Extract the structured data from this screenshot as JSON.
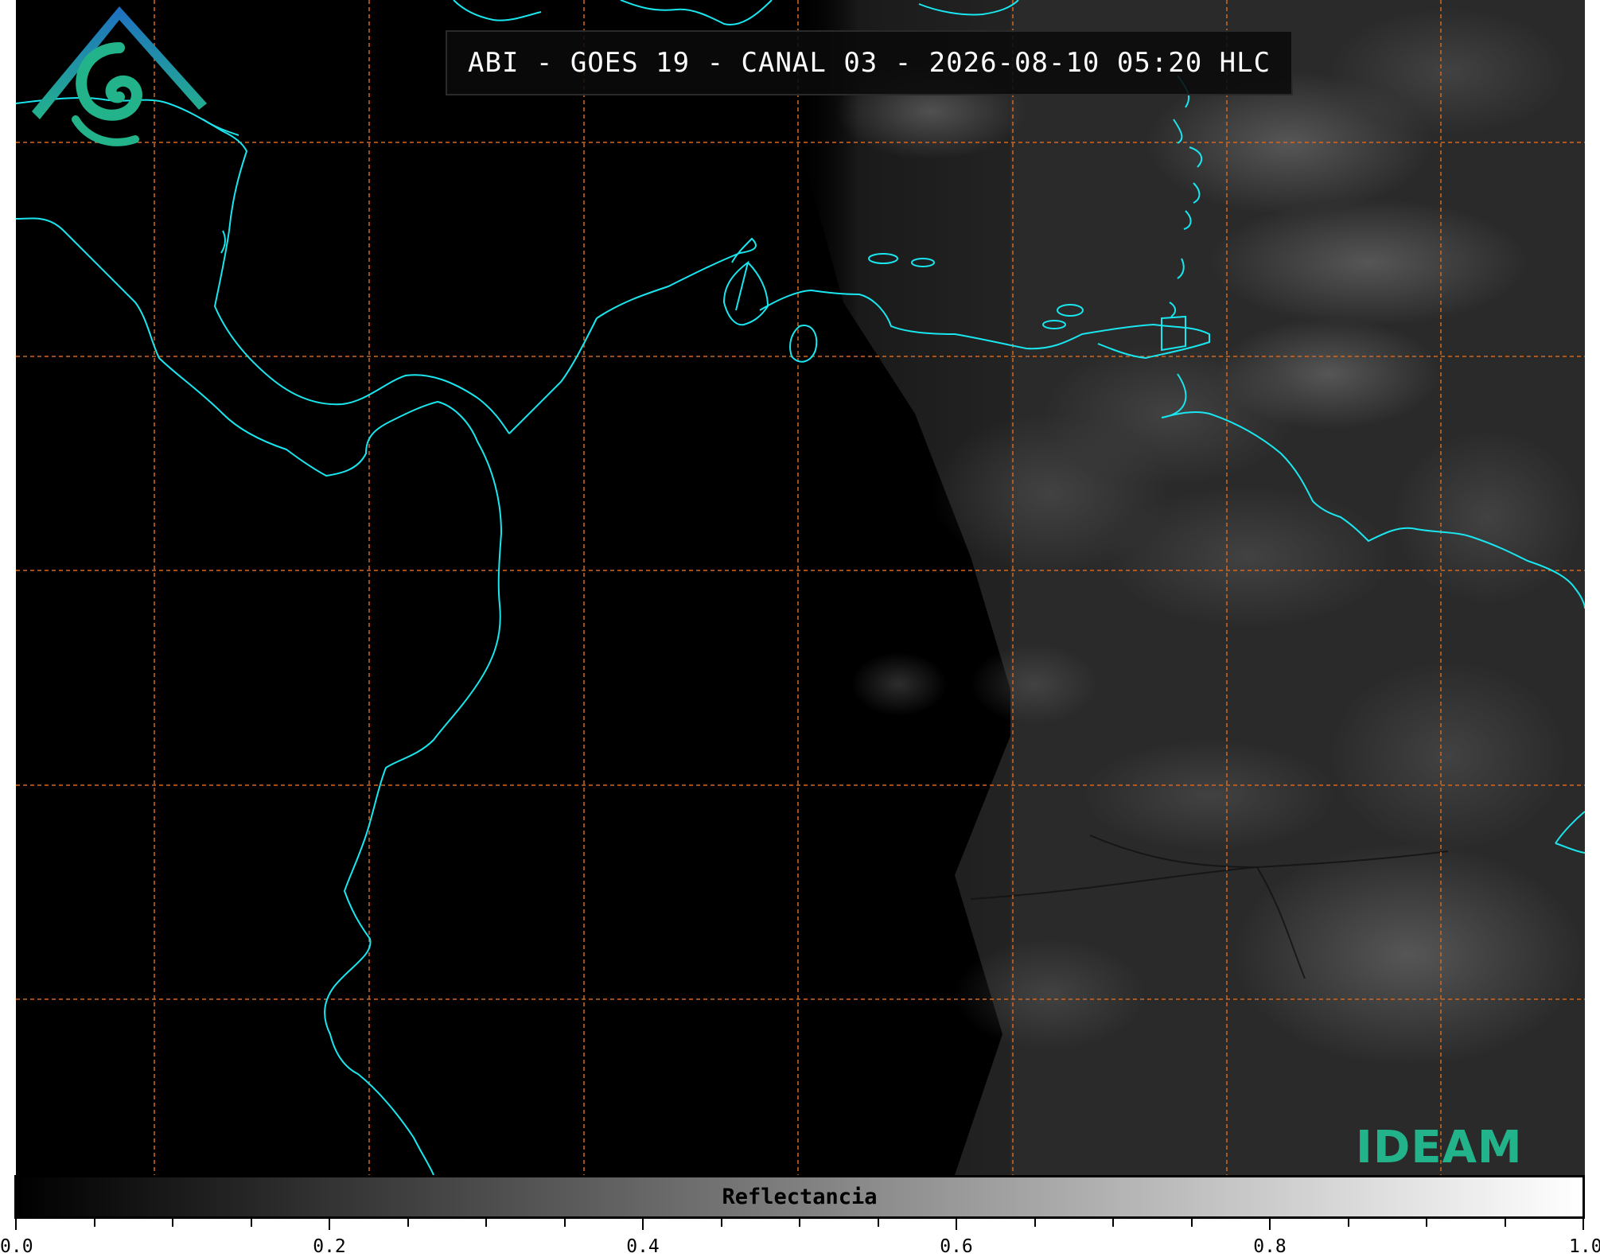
{
  "title": "ABI - GOES 19 - CANAL 03 - 2026-08-10 05:20 HLC",
  "colorbar": {
    "label": "Reflectancia",
    "min": 0.0,
    "max": 1.0,
    "tick_labels": [
      "0.0",
      "0.2",
      "0.4",
      "0.6",
      "0.8",
      "1.0"
    ],
    "tick_values": [
      0.0,
      0.2,
      0.4,
      0.6,
      0.8,
      1.0
    ],
    "minor_tick_values": [
      0.05,
      0.1,
      0.15,
      0.25,
      0.3,
      0.35,
      0.45,
      0.5,
      0.55,
      0.65,
      0.7,
      0.75,
      0.85,
      0.9,
      0.95
    ]
  },
  "logo": {
    "text": "IDEAM",
    "icon": "ideam-logo-icon"
  },
  "colors": {
    "coastline": "#19e6ee",
    "gridline": "#d2691e",
    "logo_blue": "#1f6fc2",
    "logo_green": "#22b38a"
  },
  "map": {
    "gridlines": "dashed",
    "imagery": "visible reflectance, night-to-day terminator"
  }
}
